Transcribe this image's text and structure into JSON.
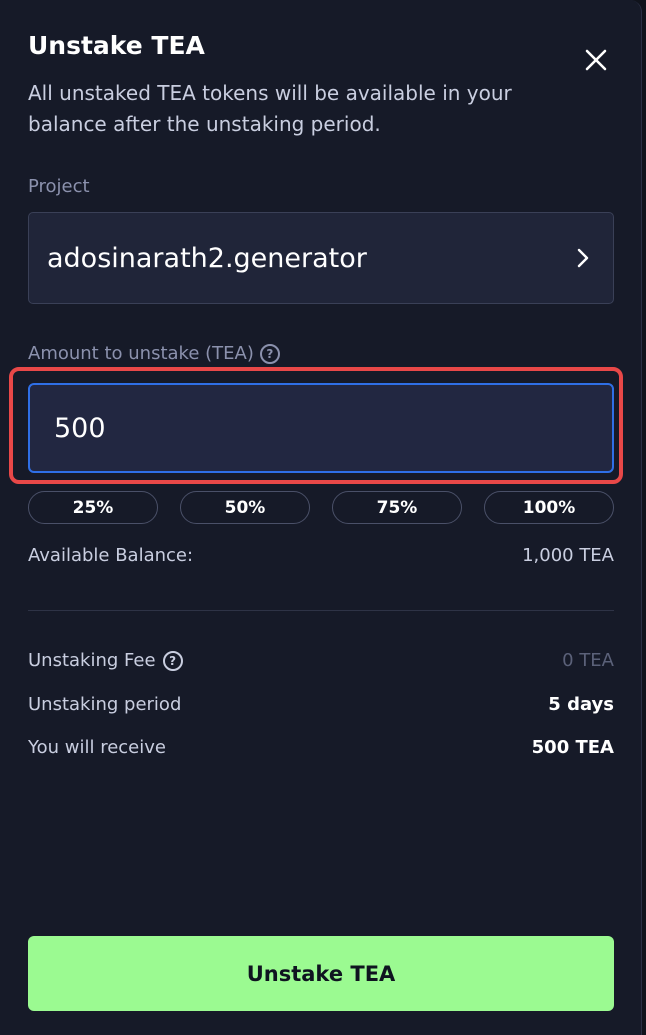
{
  "modal": {
    "title": "Unstake TEA",
    "subtitle": "All unstaked TEA tokens will be available in your balance after the unstaking period."
  },
  "project": {
    "label": "Project",
    "value": "adosinarath2.generator"
  },
  "amount": {
    "label": "Amount to unstake (TEA)",
    "value": "500"
  },
  "percent_buttons": [
    "25%",
    "50%",
    "75%",
    "100%"
  ],
  "balance": {
    "label": "Available Balance:",
    "value": "1,000 TEA"
  },
  "summary": {
    "fee_label": "Unstaking Fee",
    "fee_value": "0 TEA",
    "period_label": "Unstaking period",
    "period_value": "5 days",
    "receive_label": "You will receive",
    "receive_value": "500 TEA"
  },
  "submit_label": "Unstake TEA",
  "icons": {
    "close": "close-icon",
    "chevron": "chevron-right-icon",
    "help": "help-icon"
  },
  "colors": {
    "background": "#161a28",
    "accent_button": "#9bfa91",
    "focus_border": "#2f6fe6",
    "highlight_border": "#e84848"
  }
}
